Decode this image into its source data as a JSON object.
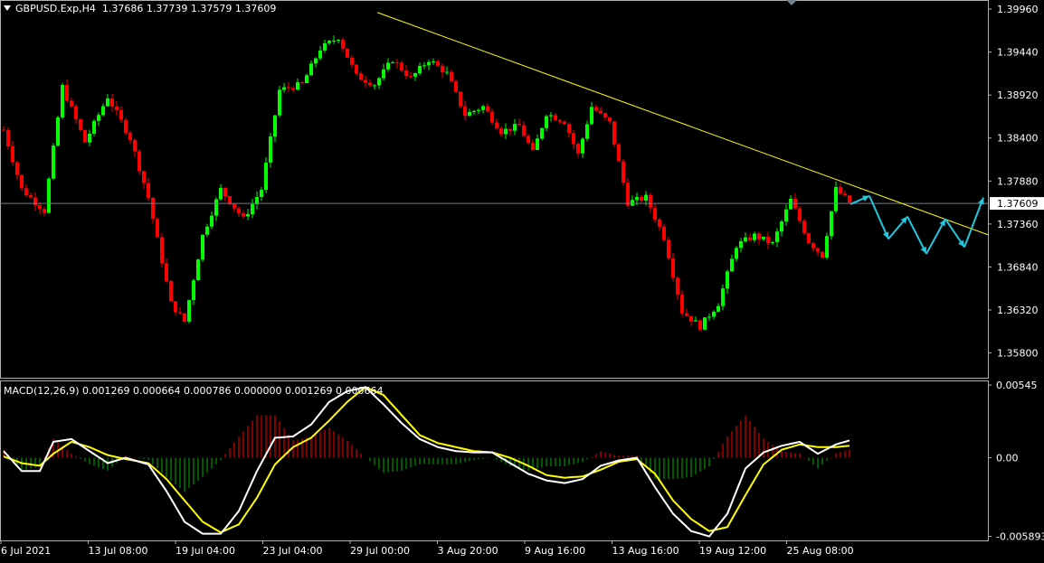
{
  "header": {
    "symbol": "GBPUSD.Exp,H4",
    "ohlc": "1.37686 1.37739 1.37579 1.37609"
  },
  "macd_header": "MACD(12,26,9) 0.001269 0.000664 0.000786 0.000000 0.001269 0.000664",
  "colors": {
    "background": "#000000",
    "bull": "#00ff00",
    "bear": "#ff0000",
    "trendline": "#ffff00",
    "forecast": "#20c8e0",
    "price_line": "#708090",
    "macd_main": "#ffffff",
    "macd_signal": "#ffff00",
    "hist_pos": "#ff0000",
    "hist_neg": "#00b000"
  },
  "chart_data": [
    {
      "type": "candlestick",
      "title": "GBPUSD.Exp,H4",
      "price_axis_labels": [
        "1.39960",
        "1.39440",
        "1.38920",
        "1.38400",
        "1.37880",
        "1.37360",
        "1.36840",
        "1.36320",
        "1.35800"
      ],
      "ylim": [
        1.355,
        1.4007
      ],
      "current_price": "1.37609",
      "time_axis_labels": [
        "6 Jul 2021",
        "13 Jul 08:00",
        "19 Jul 04:00",
        "23 Jul 04:00",
        "29 Jul 00:00",
        "3 Aug 20:00",
        "9 Aug 16:00",
        "13 Aug 16:00",
        "19 Aug 12:00",
        "25 Aug 08:00"
      ],
      "close_path": [
        [
          0,
          1.385
        ],
        [
          4,
          1.3778
        ],
        [
          9,
          1.3752
        ],
        [
          13,
          1.3902
        ],
        [
          18,
          1.3835
        ],
        [
          23,
          1.389
        ],
        [
          28,
          1.384
        ],
        [
          32,
          1.3768
        ],
        [
          37,
          1.364
        ],
        [
          40,
          1.3618
        ],
        [
          44,
          1.3722
        ],
        [
          48,
          1.3778
        ],
        [
          53,
          1.3742
        ],
        [
          57,
          1.3778
        ],
        [
          61,
          1.3898
        ],
        [
          66,
          1.3905
        ],
        [
          70,
          1.3948
        ],
        [
          74,
          1.3962
        ],
        [
          78,
          1.3915
        ],
        [
          82,
          1.3905
        ],
        [
          86,
          1.3935
        ],
        [
          90,
          1.3912
        ],
        [
          94,
          1.3935
        ],
        [
          98,
          1.3918
        ],
        [
          102,
          1.3868
        ],
        [
          106,
          1.3878
        ],
        [
          110,
          1.3848
        ],
        [
          114,
          1.3855
        ],
        [
          117,
          1.3822
        ],
        [
          120,
          1.387
        ],
        [
          124,
          1.386
        ],
        [
          127,
          1.382
        ],
        [
          130,
          1.3878
        ],
        [
          134,
          1.3858
        ],
        [
          138,
          1.3762
        ],
        [
          142,
          1.3768
        ],
        [
          146,
          1.372
        ],
        [
          150,
          1.363
        ],
        [
          154,
          1.3612
        ],
        [
          158,
          1.364
        ],
        [
          162,
          1.371
        ],
        [
          166,
          1.3722
        ],
        [
          170,
          1.3712
        ],
        [
          174,
          1.3765
        ],
        [
          178,
          1.3715
        ],
        [
          181,
          1.3698
        ],
        [
          184,
          1.3778
        ],
        [
          187,
          1.3762
        ]
      ],
      "trendline": [
        [
          1.3992
        ],
        [
          1.3723
        ]
      ],
      "forecast_zigzag": [
        1.376,
        1.377,
        1.3718,
        1.3745,
        1.37,
        1.3742,
        1.3708,
        1.3768
      ]
    },
    {
      "type": "macd",
      "title": "MACD(12,26,9)",
      "axis_labels": [
        "0.00545",
        "0.00",
        "-0.005893"
      ],
      "ylim": [
        -0.0062,
        0.0058
      ],
      "macd": [
        [
          0,
          0.0005
        ],
        [
          4,
          -0.001
        ],
        [
          8,
          -0.001
        ],
        [
          11,
          0.0012
        ],
        [
          15,
          0.0014
        ],
        [
          19,
          0.0005
        ],
        [
          23,
          -0.0004
        ],
        [
          27,
          0.0
        ],
        [
          32,
          -0.0005
        ],
        [
          36,
          -0.0025
        ],
        [
          40,
          -0.0048
        ],
        [
          44,
          -0.0057
        ],
        [
          48,
          -0.0057
        ],
        [
          52,
          -0.004
        ],
        [
          56,
          -0.001
        ],
        [
          60,
          0.0015
        ],
        [
          64,
          0.0016
        ],
        [
          68,
          0.0025
        ],
        [
          72,
          0.0042
        ],
        [
          76,
          0.005
        ],
        [
          80,
          0.0053
        ],
        [
          84,
          0.004
        ],
        [
          88,
          0.0026
        ],
        [
          92,
          0.0014
        ],
        [
          96,
          0.0008
        ],
        [
          100,
          0.0005
        ],
        [
          104,
          0.0004
        ],
        [
          108,
          0.0004
        ],
        [
          112,
          -0.0004
        ],
        [
          116,
          -0.0012
        ],
        [
          120,
          -0.0017
        ],
        [
          124,
          -0.0019
        ],
        [
          128,
          -0.0016
        ],
        [
          132,
          -0.0006
        ],
        [
          136,
          -0.0002
        ],
        [
          140,
          0.0
        ],
        [
          144,
          -0.0022
        ],
        [
          148,
          -0.0042
        ],
        [
          152,
          -0.0055
        ],
        [
          156,
          -0.0059
        ],
        [
          160,
          -0.0042
        ],
        [
          164,
          -0.0008
        ],
        [
          168,
          0.0004
        ],
        [
          172,
          0.0009
        ],
        [
          176,
          0.0012
        ],
        [
          180,
          0.0003
        ],
        [
          184,
          0.001
        ],
        [
          187,
          0.0013
        ]
      ],
      "signal": [
        [
          0,
          0.0001
        ],
        [
          4,
          -0.0004
        ],
        [
          8,
          -0.0006
        ],
        [
          11,
          0.0003
        ],
        [
          15,
          0.0012
        ],
        [
          19,
          0.0008
        ],
        [
          23,
          0.0002
        ],
        [
          27,
          -0.0001
        ],
        [
          32,
          -0.0004
        ],
        [
          36,
          -0.0016
        ],
        [
          40,
          -0.0032
        ],
        [
          44,
          -0.0048
        ],
        [
          48,
          -0.0056
        ],
        [
          52,
          -0.005
        ],
        [
          56,
          -0.003
        ],
        [
          60,
          -0.0005
        ],
        [
          64,
          0.0008
        ],
        [
          68,
          0.0015
        ],
        [
          72,
          0.0028
        ],
        [
          76,
          0.0042
        ],
        [
          80,
          0.0053
        ],
        [
          84,
          0.0047
        ],
        [
          88,
          0.0032
        ],
        [
          92,
          0.0017
        ],
        [
          96,
          0.0011
        ],
        [
          100,
          0.0008
        ],
        [
          104,
          0.0005
        ],
        [
          108,
          0.0004
        ],
        [
          112,
          0.0
        ],
        [
          116,
          -0.0006
        ],
        [
          120,
          -0.0013
        ],
        [
          124,
          -0.0015
        ],
        [
          128,
          -0.0014
        ],
        [
          132,
          -0.0009
        ],
        [
          136,
          -0.0003
        ],
        [
          140,
          -0.0001
        ],
        [
          144,
          -0.0012
        ],
        [
          148,
          -0.0032
        ],
        [
          152,
          -0.0046
        ],
        [
          156,
          -0.0055
        ],
        [
          160,
          -0.0052
        ],
        [
          164,
          -0.0028
        ],
        [
          168,
          -0.0005
        ],
        [
          172,
          0.0006
        ],
        [
          176,
          0.001
        ],
        [
          180,
          0.0008
        ],
        [
          184,
          0.0008
        ],
        [
          187,
          0.0009
        ]
      ]
    }
  ]
}
